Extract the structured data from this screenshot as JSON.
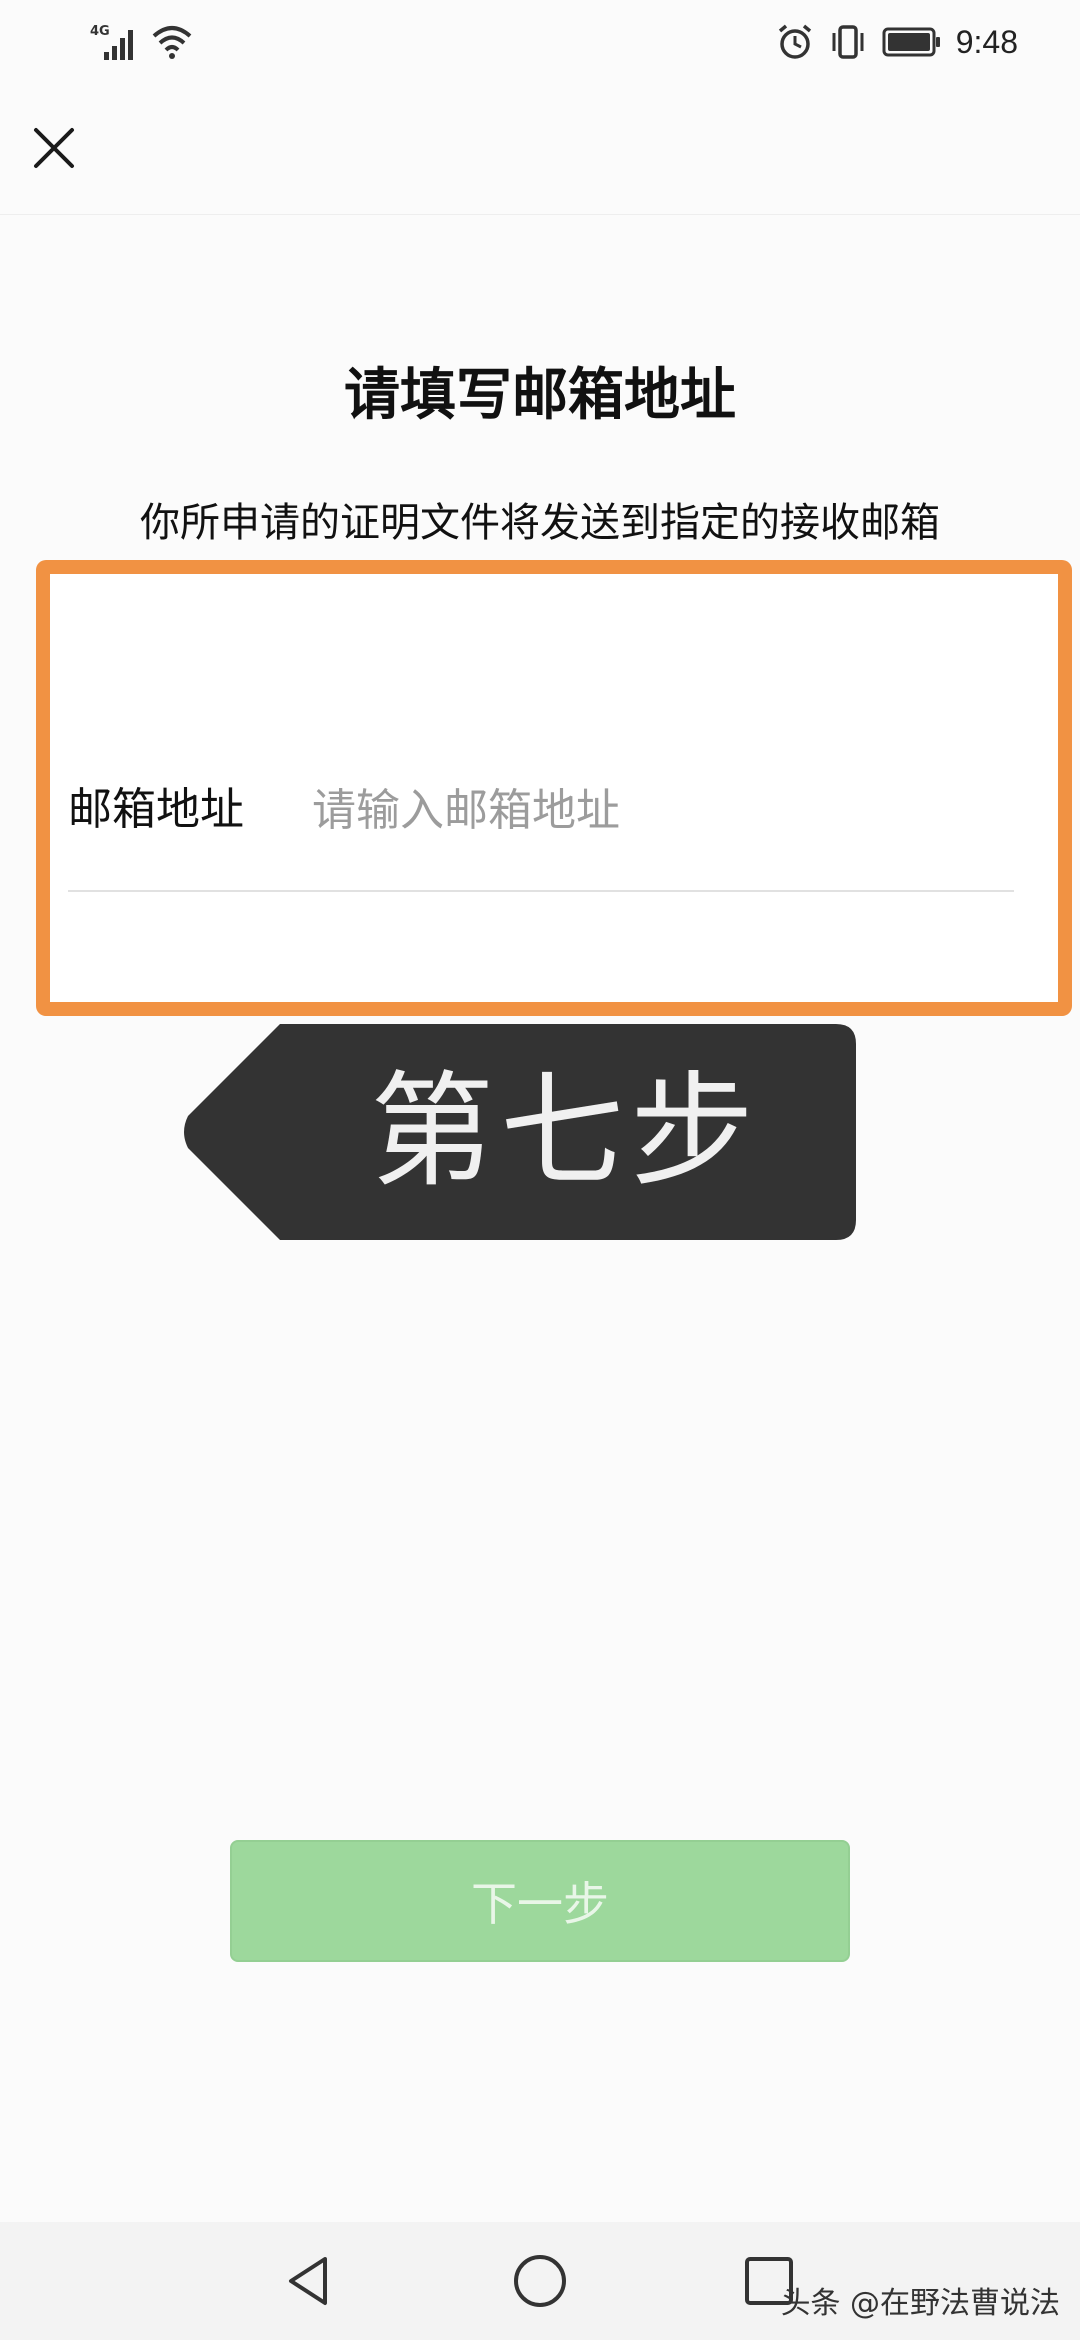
{
  "status_bar": {
    "network": "4G",
    "time": "9:48"
  },
  "header": {
    "close_icon": "close-icon"
  },
  "form": {
    "title": "请填写邮箱地址",
    "subtitle": "你所申请的证明文件将发送到指定的接收邮箱",
    "email_label": "邮箱地址",
    "email_placeholder": "请输入邮箱地址",
    "email_value": ""
  },
  "annotation": {
    "step_text": "第七步",
    "highlight_color": "#f19243",
    "banner_color": "#333333"
  },
  "actions": {
    "next_label": "下一步",
    "next_color": "#9dd89c"
  },
  "nav": {
    "back_icon": "back-triangle-icon",
    "home_icon": "home-circle-icon",
    "recents_icon": "recents-square-icon"
  },
  "watermark": {
    "text": "头条 @在野法曹说法"
  }
}
